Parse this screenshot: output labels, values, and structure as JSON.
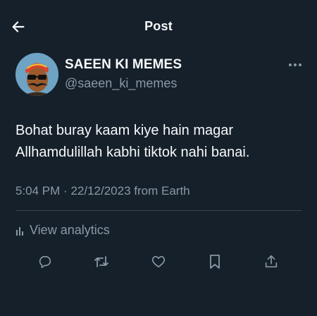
{
  "header": {
    "title": "Post",
    "back_icon": "arrow-left-icon"
  },
  "author": {
    "display_name": "SAEEN KI MEMES",
    "handle": "@saeen_ki_memes",
    "more_icon": "more-horizontal-icon"
  },
  "post": {
    "text": "Bohat buray kaam kiye hain magar\nAllhamdulillah kabhi tiktok nahi banai.",
    "time": "5:04 PM",
    "separator": "·",
    "date": "22/12/2023",
    "source": "from Earth"
  },
  "analytics": {
    "label": "View analytics",
    "icon": "bar-chart-icon"
  },
  "actions": {
    "reply_icon": "reply-icon",
    "repost_icon": "repost-icon",
    "like_icon": "heart-icon",
    "bookmark_icon": "bookmark-icon",
    "share_icon": "share-icon"
  },
  "colors": {
    "background": "#15202b",
    "text_primary": "#f7f9f9",
    "text_secondary": "#8b98a5",
    "divider": "#38444d"
  }
}
